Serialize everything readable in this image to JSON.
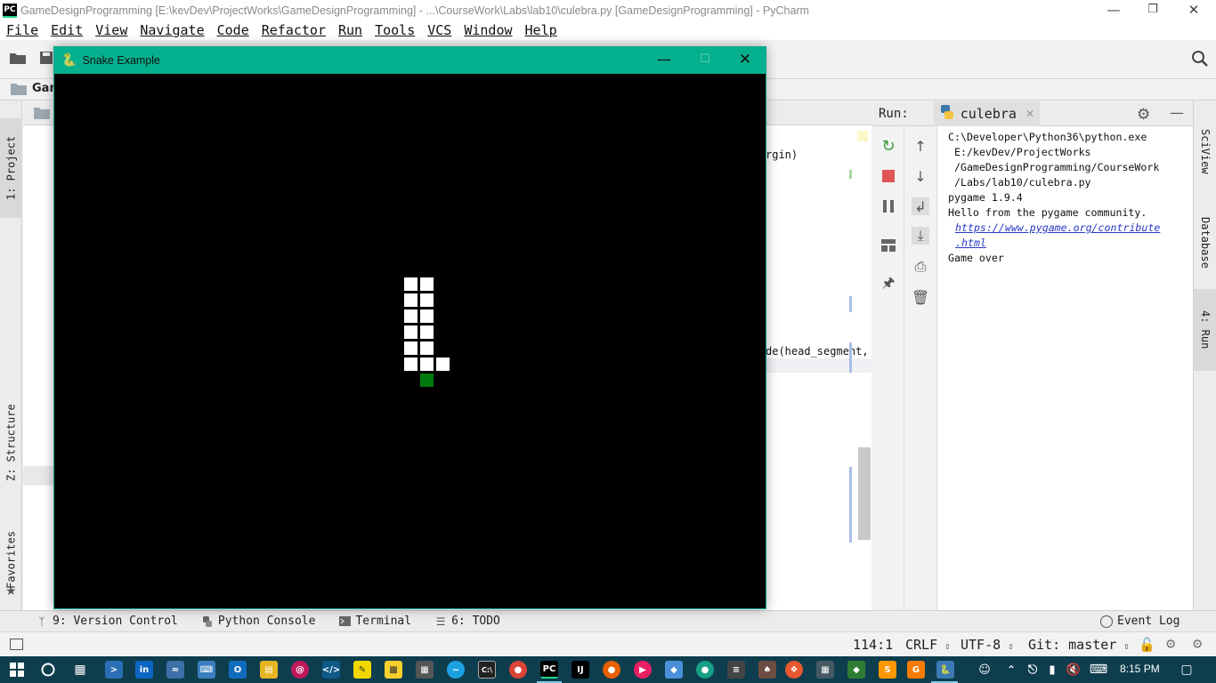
{
  "ide": {
    "window_title": "GameDesignProgramming [E:\\kevDev\\ProjectWorks\\GameDesignProgramming] - ...\\CourseWork\\Labs\\lab10\\culebra.py [GameDesignProgramming] - PyCharm",
    "logo_text": "PC",
    "menu": [
      "File",
      "Edit",
      "View",
      "Navigate",
      "Code",
      "Refactor",
      "Run",
      "Tools",
      "VCS",
      "Window",
      "Help"
    ],
    "breadcrumb_fragment": "Gam",
    "code_fragments": [
      "rgin)",
      "de(head_segment,"
    ],
    "left_tabs": [
      "1: Project",
      "Z: Structure",
      "Favorites"
    ],
    "right_tabs": [
      "SciView",
      "Database",
      "4: Run"
    ]
  },
  "run_panel": {
    "label": "Run:",
    "tab_name": "culebra",
    "console_lines": [
      {
        "text": "C:\\Developer\\Python36\\python.exe",
        "link": false
      },
      {
        "text": " E:/kevDev/ProjectWorks",
        "link": false
      },
      {
        "text": " /GameDesignProgramming/CourseWork",
        "link": false
      },
      {
        "text": " /Labs/lab10/culebra.py",
        "link": false
      },
      {
        "text": "pygame 1.9.4",
        "link": false
      },
      {
        "text": "Hello from the pygame community.",
        "link": false
      },
      {
        "text": "https://www.pygame.org/contribute",
        "link": true
      },
      {
        "text": ".html",
        "link": true
      },
      {
        "text": "Game over",
        "link": false
      }
    ]
  },
  "bottom_tools": [
    {
      "label": "9: Version Control",
      "icon": "version-control-icon"
    },
    {
      "label": "Python Console",
      "icon": "python-console-icon"
    },
    {
      "label": "Terminal",
      "icon": "terminal-icon"
    },
    {
      "label": "6: TODO",
      "icon": "todo-icon"
    }
  ],
  "event_log_label": "Event Log",
  "status_bar": {
    "position": "114:1",
    "line_sep": "CRLF",
    "encoding": "UTF-8",
    "git_branch": "Git: master"
  },
  "game_window": {
    "title": "Snake Example",
    "snake_color": "#ffffff",
    "food_color": "#00790f",
    "background": "#000000"
  },
  "taskbar": {
    "time": "8:15 PM"
  },
  "colors": {
    "game_titlebar": "#04b08e",
    "taskbar": "#0e3d4e",
    "link": "#2a39c6"
  }
}
